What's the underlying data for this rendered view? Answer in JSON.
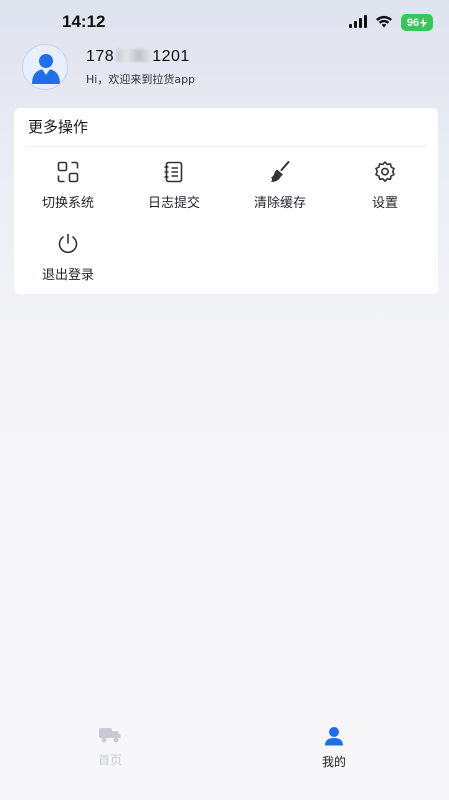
{
  "status_bar": {
    "time": "14:12",
    "battery": "96",
    "signal_icon": "cellular-signal-icon",
    "wifi_icon": "wifi-icon",
    "battery_icon": "battery-charging-icon"
  },
  "profile": {
    "phone_prefix": "178",
    "phone_suffix": "1201",
    "greeting": "Hi，欢迎来到拉货app",
    "avatar_icon": "user-avatar-icon"
  },
  "more_actions": {
    "title": "更多操作",
    "items": [
      {
        "label": "切换系统",
        "icon": "switch-system-icon"
      },
      {
        "label": "日志提交",
        "icon": "log-submit-icon"
      },
      {
        "label": "清除缓存",
        "icon": "broom-icon"
      },
      {
        "label": "设置",
        "icon": "gear-icon"
      },
      {
        "label": "退出登录",
        "icon": "power-icon"
      }
    ]
  },
  "tabbar": {
    "tabs": [
      {
        "label": "首页",
        "icon": "truck-icon",
        "active": false
      },
      {
        "label": "我的",
        "icon": "user-icon",
        "active": true
      }
    ]
  },
  "colors": {
    "accent": "#1f6feb",
    "battery_green": "#34c759",
    "inactive_tab": "#c7cbd3"
  }
}
